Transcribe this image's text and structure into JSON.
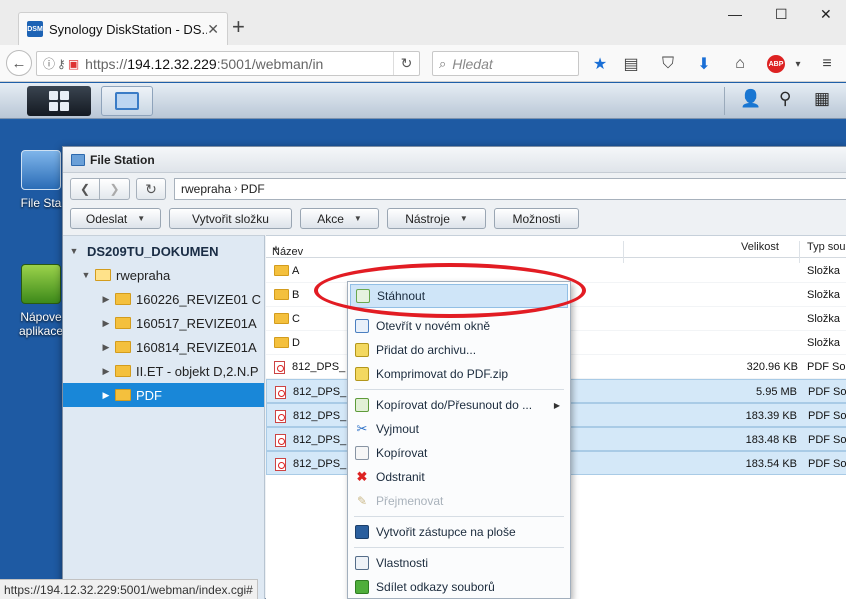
{
  "browser": {
    "tab_title": "Synology DiskStation - DS...",
    "tab_favicon_text": "DSM",
    "url_prefix": "https://",
    "url_host": "194.12.32.229",
    "url_rest": ":5001/webman/in",
    "search_placeholder": "Hledat",
    "status_url": "https://194.12.32.229:5001/webman/index.cgi#"
  },
  "desktop": {
    "icons": [
      {
        "label": "File Sta",
        "icon": "file-station-icon"
      },
      {
        "label": "Nápove aplikace",
        "icon": "help-book-icon"
      }
    ]
  },
  "file_station": {
    "title": "File Station",
    "path": [
      "rwepraha",
      "PDF"
    ],
    "toolbar": {
      "upload": "Odeslat",
      "create_folder": "Vytvořit složku",
      "action": "Akce",
      "tools": "Nástroje",
      "settings": "Možnosti"
    },
    "tree": {
      "root": "DS209TU_DOKUMEN",
      "share": "rwepraha",
      "folders": [
        "160226_REVIZE01 C",
        "160517_REVIZE01A",
        "160814_REVIZE01A",
        "II.ET - objekt D,2.N.P",
        "PDF"
      ]
    },
    "columns": {
      "name": "Název",
      "size": "Velikost",
      "type": "Typ sou"
    },
    "rows": [
      {
        "name": "A",
        "size": "",
        "type": "Složka",
        "kind": "folder"
      },
      {
        "name": "B",
        "size": "",
        "type": "Složka",
        "kind": "folder"
      },
      {
        "name": "C",
        "size": "",
        "type": "Složka",
        "kind": "folder"
      },
      {
        "name": "D",
        "size": "",
        "type": "Složka",
        "kind": "folder"
      },
      {
        "name": "812_DPS_",
        "size": "320.96 KB",
        "type": "PDF So",
        "kind": "pdf"
      },
      {
        "name": "812_DPS_",
        "size": "5.95 MB",
        "type": "PDF So",
        "kind": "pdf"
      },
      {
        "name": "812_DPS_",
        "size": "183.39 KB",
        "type": "PDF So",
        "kind": "pdf"
      },
      {
        "name": "812_DPS_",
        "size": "183.48 KB",
        "type": "PDF So",
        "kind": "pdf"
      },
      {
        "name": "812_DPS_",
        "size": "183.54 KB",
        "type": "PDF So",
        "kind": "pdf"
      }
    ]
  },
  "context_menu": {
    "download": "Stáhnout",
    "open_new_window": "Otevřít v novém okně",
    "add_archive": "Přidat do archivu...",
    "compress_zip": "Komprimovat do PDF.zip",
    "copy_move": "Kopírovat do/Přesunout do ...",
    "cut": "Vyjmout",
    "copy": "Kopírovat",
    "delete": "Odstranit",
    "rename": "Přejmenovat",
    "create_shortcut": "Vytvořit zástupce na ploše",
    "properties": "Vlastnosti",
    "share_links": "Sdílet odkazy souborů"
  },
  "colors": {
    "desktop": "#1e5aa3",
    "selection": "#1987d8",
    "highlight_ellipse": "#e21c23"
  }
}
